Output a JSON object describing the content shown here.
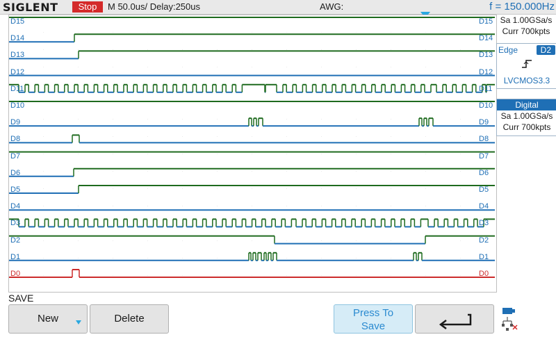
{
  "header": {
    "brand": "SIGLENT",
    "run_state": "Stop",
    "timebase": "M 50.0us/",
    "delay": "Delay:250us",
    "awg": "AWG:",
    "frequency": "f = 150.000Hz"
  },
  "side_panel": {
    "sample_rate": "Sa 1.00GSa/s",
    "memory": "Curr 700kpts",
    "trigger_type": "Edge",
    "trigger_source": "D2",
    "logic_level": "LVCMOS3.3",
    "digital_title": "Digital",
    "digital_sample_rate": "Sa 1.00GSa/s",
    "digital_memory": "Curr 700kpts"
  },
  "channels": [
    {
      "name": "D15",
      "color": "#1f6fb5"
    },
    {
      "name": "D14",
      "color": "#1f6fb5"
    },
    {
      "name": "D13",
      "color": "#1f6fb5"
    },
    {
      "name": "D12",
      "color": "#1f6fb5"
    },
    {
      "name": "D11",
      "color": "#1f6fb5"
    },
    {
      "name": "D10",
      "color": "#1f6fb5"
    },
    {
      "name": "D9",
      "color": "#1f6fb5"
    },
    {
      "name": "D8",
      "color": "#1f6fb5"
    },
    {
      "name": "D7",
      "color": "#1f6fb5"
    },
    {
      "name": "D6",
      "color": "#1f6fb5"
    },
    {
      "name": "D5",
      "color": "#1f6fb5"
    },
    {
      "name": "D4",
      "color": "#1f6fb5"
    },
    {
      "name": "D3",
      "color": "#1f6fb5"
    },
    {
      "name": "D2",
      "color": "#1f6fb5"
    },
    {
      "name": "D1",
      "color": "#1f6fb5"
    },
    {
      "name": "D0",
      "color": "#cc2b2b"
    }
  ],
  "softkeys": {
    "menu_title": "SAVE",
    "new": "New",
    "delete": "Delete",
    "press_to_save_1": "Press To",
    "press_to_save_2": "Save"
  },
  "icons": {
    "trigger_marker": "trigger-position-arrow",
    "edge": "rising-edge-icon",
    "back": "return-arrow-icon",
    "network": "network-status-icon"
  },
  "colors": {
    "low_trace": "#1f6fb5",
    "high_trace": "#1e6a1e",
    "d0_trace": "#cc2b2b",
    "accent": "#1f6fb5",
    "stop": "#d42a2a"
  }
}
